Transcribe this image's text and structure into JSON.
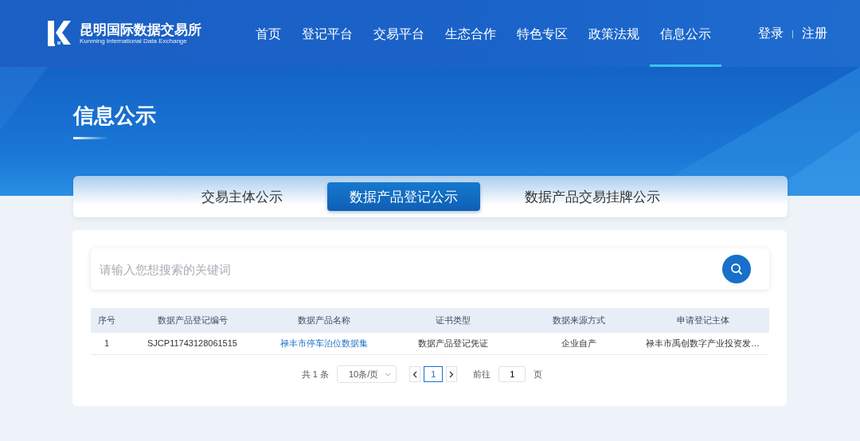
{
  "logo": {
    "name": "昆明国际数据交易所",
    "subtitle": "Kunming International Data Exchange"
  },
  "nav": [
    {
      "label": "首页",
      "selected": false
    },
    {
      "label": "登记平台",
      "selected": false
    },
    {
      "label": "交易平台",
      "selected": false
    },
    {
      "label": "生态合作",
      "selected": false
    },
    {
      "label": "特色专区",
      "selected": false
    },
    {
      "label": "政策法规",
      "selected": false
    },
    {
      "label": "信息公示",
      "selected": true
    }
  ],
  "account": {
    "login": "登录",
    "separator": "|",
    "register": "注册"
  },
  "page_title": "信息公示",
  "tabs": [
    {
      "label": "交易主体公示",
      "selected": false
    },
    {
      "label": "数据产品登记公示",
      "selected": true
    },
    {
      "label": "数据产品交易挂牌公示",
      "selected": false
    }
  ],
  "search": {
    "placeholder": "请输入您想搜索的关键词"
  },
  "table": {
    "columns": [
      "序号",
      "数据产品登记编号",
      "数据产品名称",
      "证书类型",
      "数据来源方式",
      "申请登记主体"
    ],
    "rows": [
      {
        "cells": [
          "1",
          "SJCP11743128061515",
          "禄丰市停车泊位数据集",
          "数据产品登记凭证",
          "企业自产",
          "禄丰市禹创数字产业投资发…"
        ]
      }
    ]
  },
  "pagination": {
    "total": "共 1 条",
    "page_size": "10条/页",
    "pages": [
      {
        "label": "1",
        "selected": true
      }
    ],
    "goto_label": "前往",
    "goto_value": "1",
    "goto_suffix": "页"
  }
}
